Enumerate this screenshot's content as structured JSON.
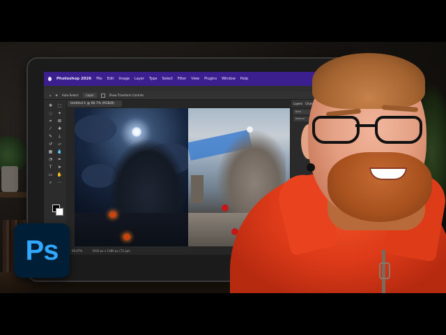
{
  "menubar": {
    "app_name": "Photoshop 2026",
    "items": [
      "File",
      "Edit",
      "Image",
      "Layer",
      "Type",
      "Select",
      "Filter",
      "View",
      "Plugins",
      "Window",
      "Help"
    ]
  },
  "window_title": "Adobe Photoshop 2026",
  "options_bar": {
    "auto_select": "Auto-Select:",
    "auto_select_target": "Layer",
    "show_transform": "Show Transform Controls"
  },
  "document_tab": "Untitled-1 @ 66.7% (RGB/8)",
  "panels": {
    "tabs": [
      "Layers",
      "Channels"
    ],
    "search_label": "Kind",
    "blend_mode": "Normal"
  },
  "status": {
    "zoom": "66.67%",
    "doc_size": "1920 px x 1080 px (72 ppi)"
  },
  "logo": {
    "text": "Ps"
  },
  "colors": {
    "menubar": "#3b1f8f",
    "ps_logo_bg": "#001e36",
    "ps_logo_text": "#31a8ff",
    "hoodie": "#e03c1a"
  },
  "icons": [
    "move-tool-icon",
    "marquee-tool-icon",
    "lasso-tool-icon",
    "crop-tool-icon",
    "brush-tool-icon",
    "eraser-tool-icon",
    "text-tool-icon",
    "hand-tool-icon",
    "zoom-tool-icon"
  ]
}
